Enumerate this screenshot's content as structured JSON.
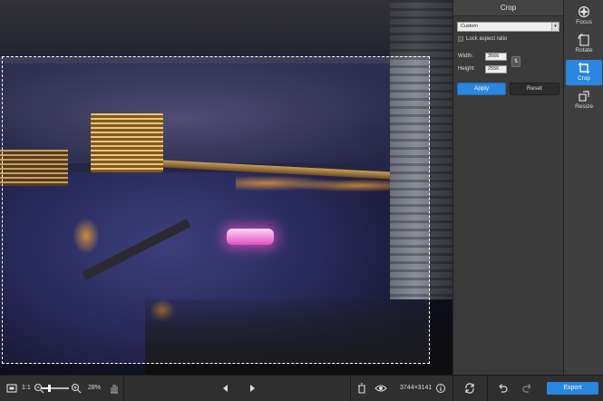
{
  "panel": {
    "title": "Crop",
    "preset_value": "Custom",
    "lock_label": "Lock aspect ratio",
    "width_label": "Width:",
    "width_value": "3566",
    "height_label": "Height:",
    "height_value": "2556",
    "apply_label": "Apply",
    "reset_label": "Reset"
  },
  "tools": [
    {
      "label": "Focus",
      "icon": "focus-icon"
    },
    {
      "label": "Rotate",
      "icon": "rotate-icon"
    },
    {
      "label": "Crop",
      "icon": "crop-icon",
      "active": true
    },
    {
      "label": "Resize",
      "icon": "resize-icon"
    }
  ],
  "bottombar": {
    "ratio_label": "1:1",
    "zoom_percent": "28%",
    "zoom_level": 0.28,
    "image_size": "3744×3141",
    "export_label": "Export"
  },
  "colors": {
    "accent": "#2a86e0",
    "panel_bg": "#3a3a3a",
    "toolbar_bg": "#2f2f2f"
  }
}
